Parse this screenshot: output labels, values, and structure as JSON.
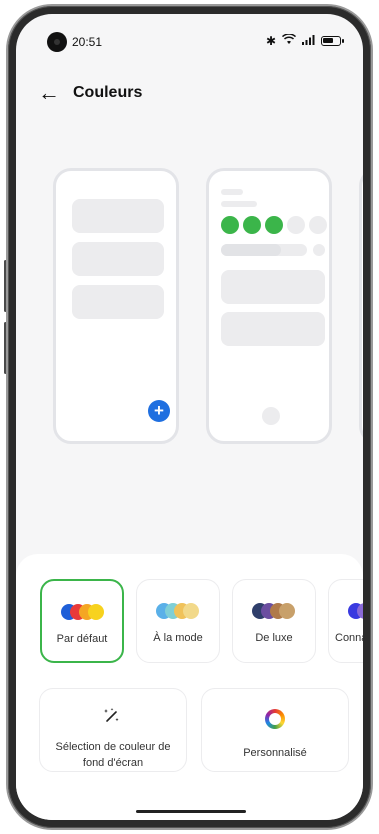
{
  "status": {
    "time": "20:51",
    "icons": [
      "bluetooth-icon",
      "wifi-icon",
      "signal-icon",
      "battery-icon"
    ]
  },
  "header": {
    "back_icon": "arrow-left-icon",
    "title": "Couleurs"
  },
  "preview": {
    "accent_dots": [
      "#3bb54a",
      "#3bb54a",
      "#3bb54a"
    ],
    "fab_color": "#1f6fe0"
  },
  "styles": [
    {
      "label": "Par défaut",
      "selected": true,
      "colors": [
        "#1f5fd8",
        "#e83a3a",
        "#f5a623",
        "#f7d21e"
      ]
    },
    {
      "label": "À la mode",
      "selected": false,
      "colors": [
        "#5ab0e8",
        "#7fcfd6",
        "#f0c25a",
        "#f2d98a"
      ]
    },
    {
      "label": "De luxe",
      "selected": false,
      "colors": [
        "#2f3f6b",
        "#6b4ea0",
        "#b07a4a",
        "#c8a06a"
      ]
    },
    {
      "label": "Conna",
      "selected": false,
      "colors": [
        "#3a3ae0",
        "#8a6ad8"
      ]
    }
  ],
  "options": {
    "wallpaper": {
      "icon": "magic-wand-icon",
      "label": "Sélection de couleur de fond d'écran"
    },
    "custom": {
      "icon": "color-ring-icon",
      "label": "Personnalisé"
    }
  }
}
